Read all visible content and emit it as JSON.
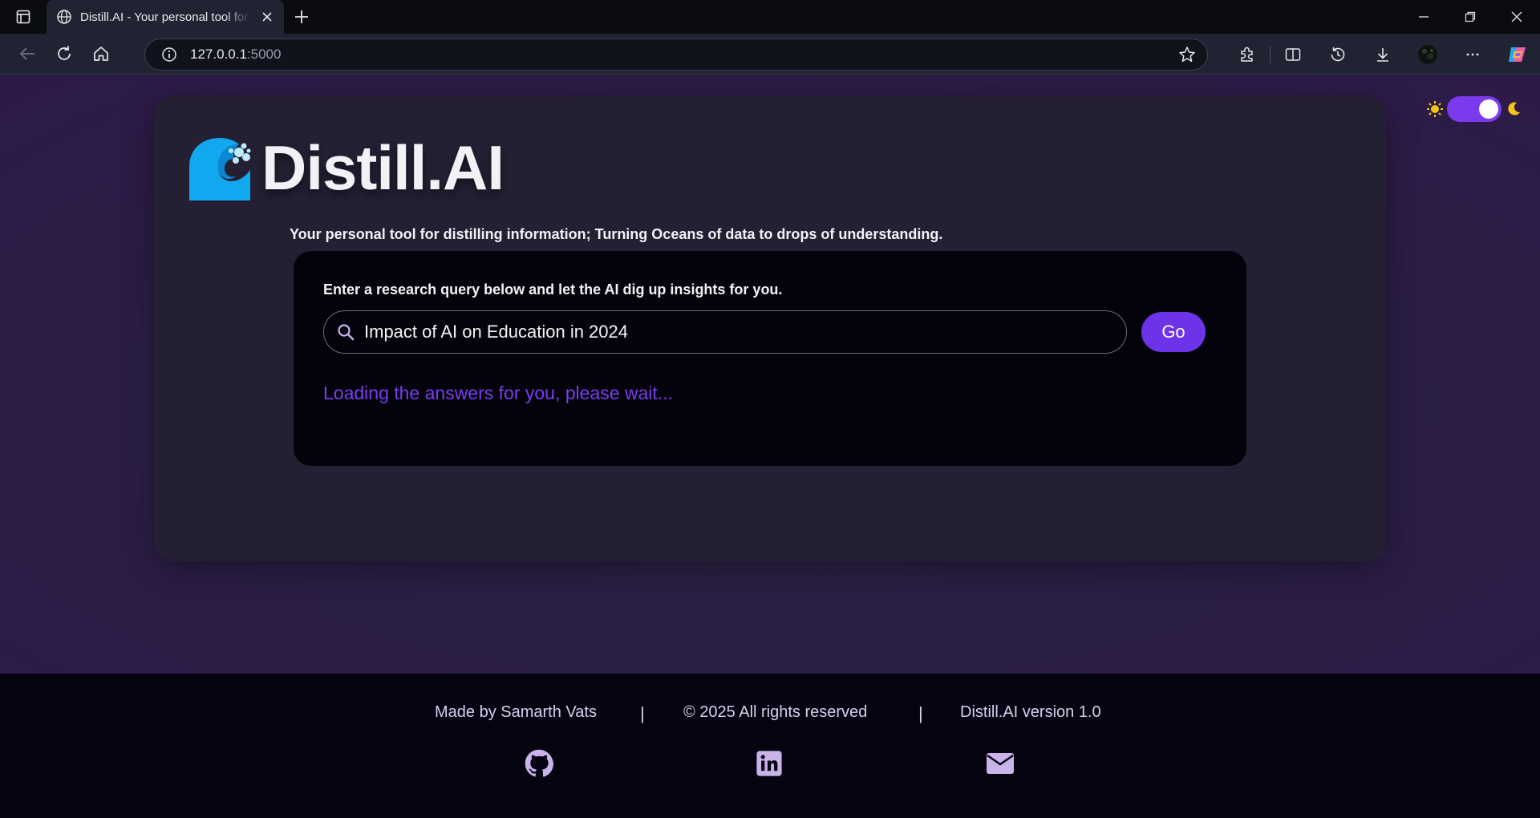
{
  "browser": {
    "tab_title": "Distill.AI - Your personal tool for distilling information",
    "url_host": "127.0.0.1",
    "url_port": ":5000"
  },
  "app": {
    "brand": "Distill.AI",
    "tagline": "Your personal tool for distilling information; Turning Oceans of data to drops of understanding.",
    "theme_toggle_on": true
  },
  "search": {
    "label": "Enter a research query below and let the AI dig up insights for you.",
    "value": "Impact of AI on Education in 2024",
    "go_label": "Go",
    "status": "Loading the answers for you, please wait..."
  },
  "footer": {
    "made_by": "Made by Samarth Vats",
    "copyright": "© 2025 All rights reserved",
    "version": "Distill.AI version 1.0",
    "separator": "|",
    "links": [
      "github-icon",
      "linkedin-icon",
      "envelope-icon"
    ]
  },
  "colors": {
    "accent": "#6d33e8",
    "loading_text": "#7a3cf0",
    "footer_icon": "#c9b3ea",
    "logo_blue": "#12a8f0"
  }
}
